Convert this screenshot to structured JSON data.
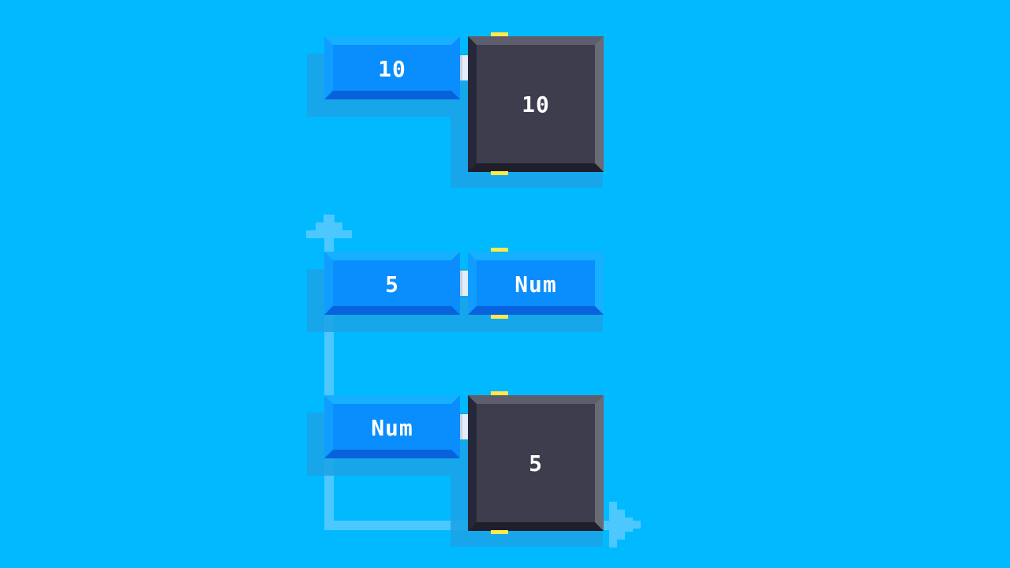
{
  "board": {
    "rows": [
      {
        "input_label": "10",
        "output_label": "10",
        "output_kind": "result"
      },
      {
        "input_label": "5",
        "output_label": "Num",
        "output_kind": "variable"
      },
      {
        "input_label": "Num",
        "output_label": "5",
        "output_kind": "result"
      }
    ]
  },
  "colors": {
    "background": "#00b9ff",
    "input_tile": "#0a8dfd",
    "result_tile": "#3d3d4e",
    "port_tick": "#ffe94d",
    "flow_path": "#4cc8ff"
  },
  "icons": {
    "flow_start": "arrow-up-icon",
    "flow_end": "arrow-right-icon"
  }
}
